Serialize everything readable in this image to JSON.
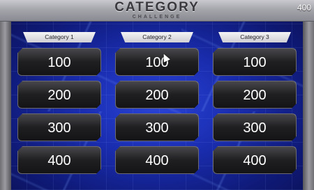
{
  "header": {
    "title": "CATEGORY",
    "subtitle": "CHALLENGE",
    "score": "400"
  },
  "board": {
    "columns": [
      {
        "category": "Category 1",
        "tiles": [
          "100",
          "200",
          "300",
          "400"
        ]
      },
      {
        "category": "Category 2",
        "tiles": [
          "100",
          "200",
          "300",
          "400"
        ]
      },
      {
        "category": "Category 3",
        "tiles": [
          "100",
          "200",
          "300",
          "400"
        ]
      }
    ]
  },
  "colors": {
    "background_blue": "#1a2db0",
    "tile_dark": "#1f1f22",
    "header_silver": "#a5a5ac"
  },
  "icons": {
    "cursor": "mouse-pointer-icon"
  }
}
